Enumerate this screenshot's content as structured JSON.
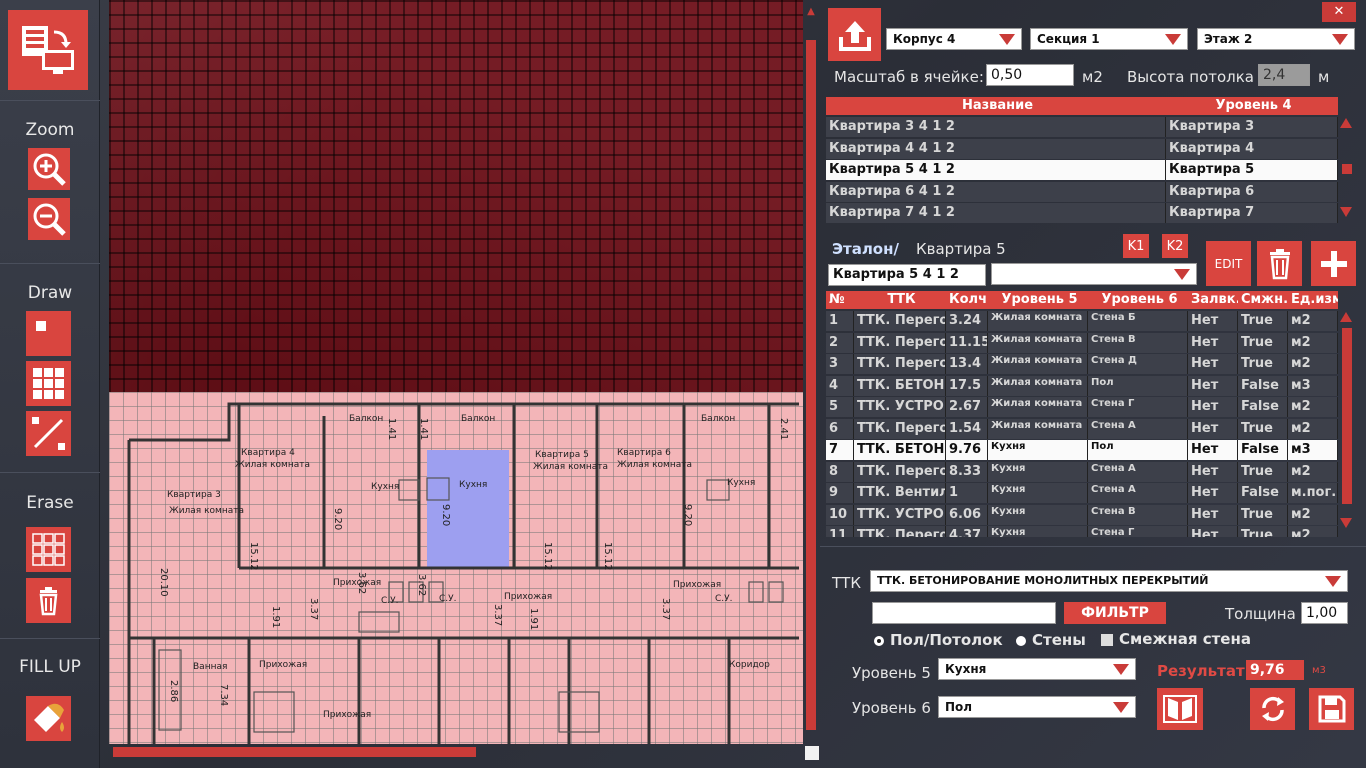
{
  "toolbar": {
    "zoom_label": "Zoom",
    "draw_label": "Draw",
    "erase_label": "Erase",
    "fill_label": "FILL UP"
  },
  "close_label": "✕",
  "combos": {
    "korpus": "Корпус 4",
    "section": "Секция 1",
    "floor": "Этаж 2"
  },
  "scale": {
    "label": "Масштаб в ячейке:",
    "value": "0,50",
    "unit": "м2",
    "height_label": "Высота потолка",
    "height_value": "2,4",
    "height_unit": "м"
  },
  "apt_table": {
    "headers": [
      "Название",
      "Уровень 4"
    ],
    "rows": [
      [
        "Квартира 3 4  1 2",
        "Квартира 3"
      ],
      [
        "Квартира 4 4  1 2",
        "Квартира 4"
      ],
      [
        "Квартира 5 4  1 2",
        "Квартира 5"
      ],
      [
        "Квартира 6 4  1 2",
        "Квартира 6"
      ],
      [
        "Квартира 7 4  1 2",
        "Квартира 7"
      ]
    ],
    "selected": 2
  },
  "etalon": {
    "label": "Эталон/",
    "value": "Квартира 5",
    "name_input": "Квартира 5 4  1 2",
    "combo": "",
    "k1": "K1",
    "k2": "K2",
    "edit": "EDIT"
  },
  "ttk_table": {
    "headers": [
      "№",
      "ТТК",
      "Колч.",
      "Уровень 5",
      "Уровень 6",
      "Залвк.",
      "Смжн.",
      "Ед.изм"
    ],
    "rows": [
      [
        "1",
        "ТТК. Перегор",
        "3.24",
        "Жилая комната",
        "Стена Б",
        "Нет",
        "True",
        "м2"
      ],
      [
        "2",
        "ТТК. Перегор",
        "11.15",
        "Жилая комната",
        "Стена В",
        "Нет",
        "True",
        "м2"
      ],
      [
        "3",
        "ТТК. Перегор",
        "13.4",
        "Жилая комната",
        "Стена Д",
        "Нет",
        "True",
        "м2"
      ],
      [
        "4",
        "ТТК. БЕТОНИ",
        "17.5",
        "Жилая комната",
        "Пол",
        "Нет",
        "False",
        "м3"
      ],
      [
        "5",
        "ТТК. УСТРОЙ",
        "2.67",
        "Жилая комната",
        "Стена Г",
        "Нет",
        "False",
        "м2"
      ],
      [
        "6",
        "ТТК. Перегор",
        "1.54",
        "Жилая комната",
        "Стена А",
        "Нет",
        "True",
        "м2"
      ],
      [
        "7",
        "ТТК. БЕТОНИ",
        "9.76",
        "Кухня",
        "Пол",
        "Нет",
        "False",
        "м3"
      ],
      [
        "8",
        "ТТК. Перегор",
        "8.33",
        "Кухня",
        "Стена А",
        "Нет",
        "True",
        "м2"
      ],
      [
        "9",
        "ТТК. Вентил",
        "1",
        "Кухня",
        "Стена А",
        "Нет",
        "False",
        "м.пог."
      ],
      [
        "10",
        "ТТК. УСТРОЙ",
        "6.06",
        "Кухня",
        "Стена В",
        "Нет",
        "True",
        "м2"
      ],
      [
        "11",
        "ТТК. Перегор",
        "4.37",
        "Кухня",
        "Стена Г",
        "Нет",
        "True",
        "м2"
      ]
    ],
    "selected": 6
  },
  "ttk_form": {
    "ttk_label": "ТТК",
    "ttk_value": "ТТК. БЕТОНИРОВАНИЕ МОНОЛИТНЫХ ПЕРЕКРЫТИЙ",
    "filter_input": "",
    "filter_btn": "ФИЛЬТР",
    "thickness_label": "Толщина",
    "thickness_value": "1,00",
    "radio_floor": "Пол/Потолок",
    "radio_walls": "Стены",
    "adj_wall": "Смежная стена",
    "lvl5_label": "Уровень 5",
    "lvl5_value": "Кухня",
    "lvl6_label": "Уровень 6",
    "lvl6_value": "Пол",
    "result_label": "Результат",
    "result_value": "9,76",
    "result_unit": "м3"
  },
  "plan": {
    "labels": [
      "Балкон",
      "Балкон",
      "Балкон",
      "Квартира 4",
      "Жилая комната",
      "Квартира 5",
      "Жилая комната",
      "Квартира 6",
      "Жилая комната",
      "Квартира 3",
      "Жилая комната",
      "Кухня",
      "Кухня",
      "Кухня",
      "Прихожая",
      "Прихожая",
      "Прихожая",
      "С.У.",
      "С.У.",
      "С.У.",
      "Коридор",
      "Ванная",
      "Прихожая",
      "Прихожая"
    ],
    "dims": [
      "15.12",
      "15.12",
      "15.12",
      "9.20",
      "9.20",
      "9.20",
      "20.10",
      "3.62",
      "3.62",
      "3.37",
      "3.37",
      "3.37",
      "1.91",
      "1.91",
      "2.86",
      "7.34",
      "1.41",
      "1.41",
      "2.41"
    ]
  },
  "accent": "#d9453f"
}
